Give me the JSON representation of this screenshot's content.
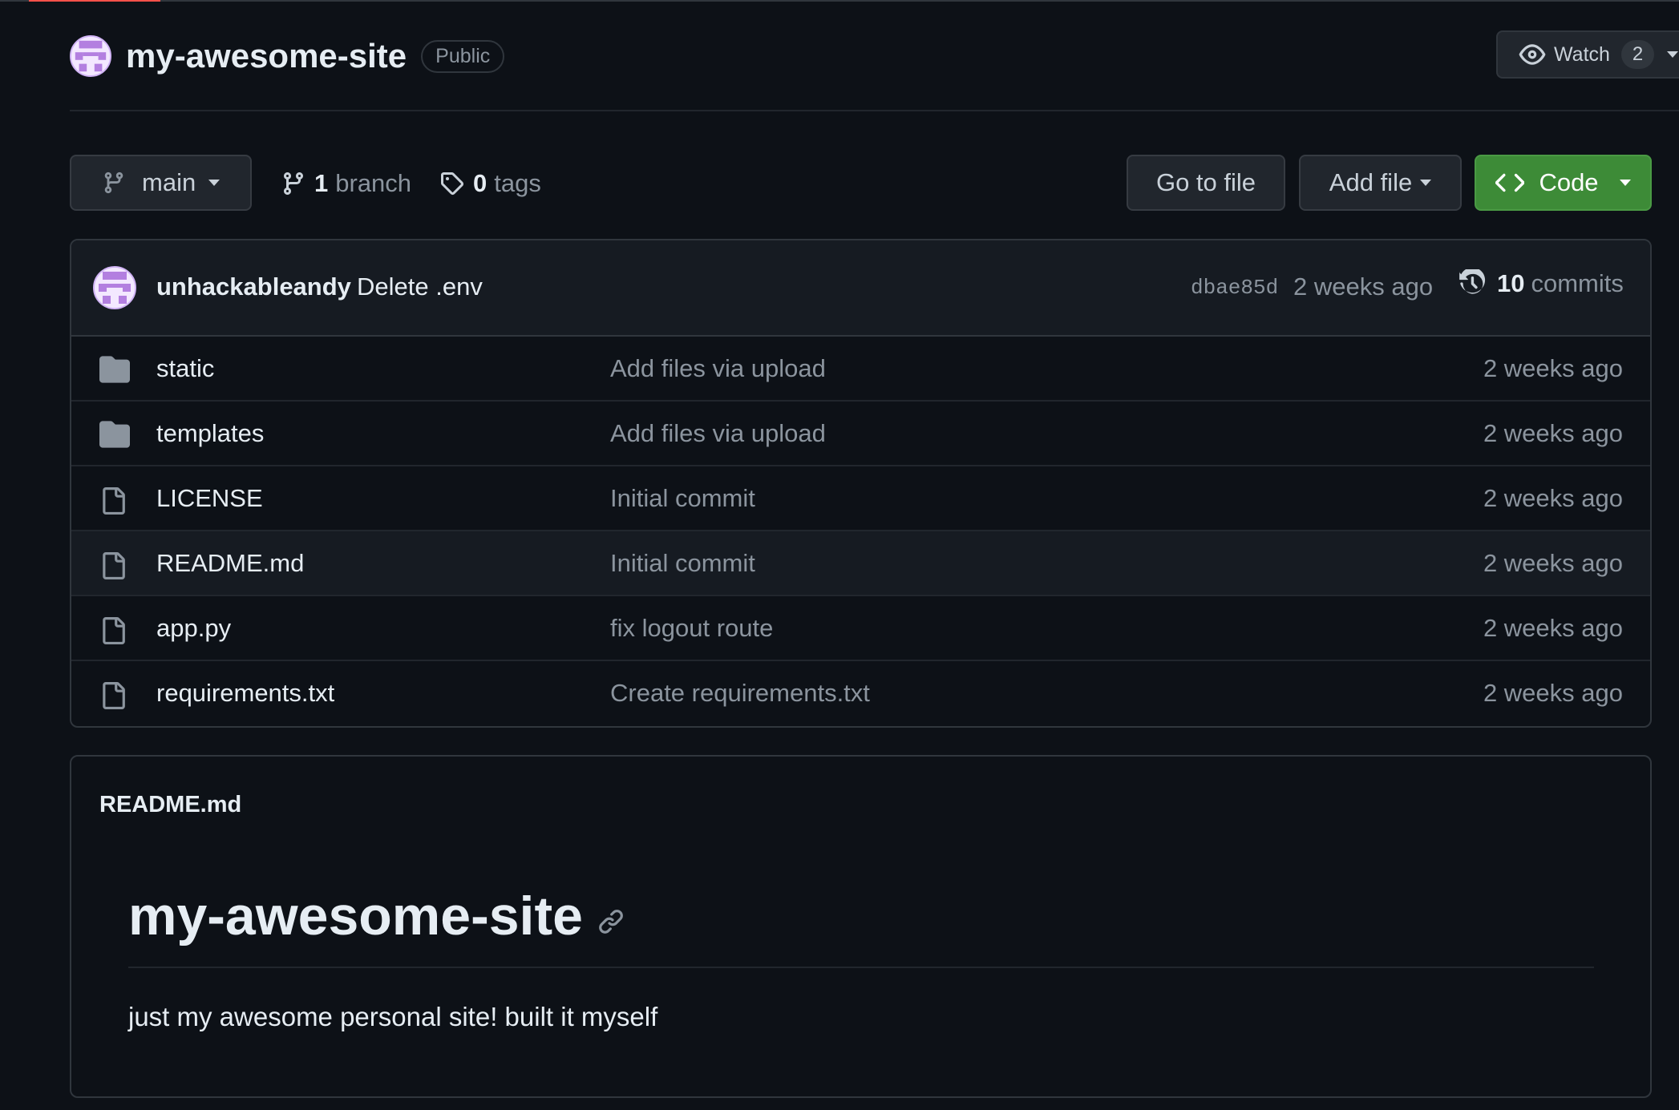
{
  "repo": {
    "name": "my-awesome-site",
    "visibility": "Public",
    "watch_label": "Watch",
    "watch_count": "2"
  },
  "toolbar": {
    "branch": "main",
    "branch_count": "1",
    "branch_label": "branch",
    "tag_count": "0",
    "tag_label": "tags",
    "go_to_file": "Go to file",
    "add_file": "Add file",
    "code": "Code"
  },
  "latest_commit": {
    "author": "unhackableandy",
    "message": "Delete .env",
    "sha": "dbae85d",
    "time": "2 weeks ago",
    "commit_count": "10",
    "commit_label": "commits"
  },
  "files": [
    {
      "name": "static",
      "type": "folder",
      "message": "Add files via upload",
      "time": "2 weeks ago"
    },
    {
      "name": "templates",
      "type": "folder",
      "message": "Add files via upload",
      "time": "2 weeks ago"
    },
    {
      "name": "LICENSE",
      "type": "file",
      "message": "Initial commit",
      "time": "2 weeks ago"
    },
    {
      "name": "README.md",
      "type": "file",
      "message": "Initial commit",
      "time": "2 weeks ago"
    },
    {
      "name": "app.py",
      "type": "file",
      "message": "fix logout route",
      "time": "2 weeks ago"
    },
    {
      "name": "requirements.txt",
      "type": "file",
      "message": "Create requirements.txt",
      "time": "2 weeks ago"
    }
  ],
  "readme": {
    "filename": "README.md",
    "heading": "my-awesome-site",
    "body": "just my awesome personal site! built it myself"
  },
  "colors": {
    "background": "#0d1117",
    "code_button": "#3d8b37",
    "muted_text": "#8b949e"
  },
  "icons": [
    "repo-avatar",
    "eye-icon",
    "git-branch-icon",
    "tag-icon",
    "code-icon",
    "history-icon",
    "folder-icon",
    "file-icon",
    "link-icon"
  ]
}
